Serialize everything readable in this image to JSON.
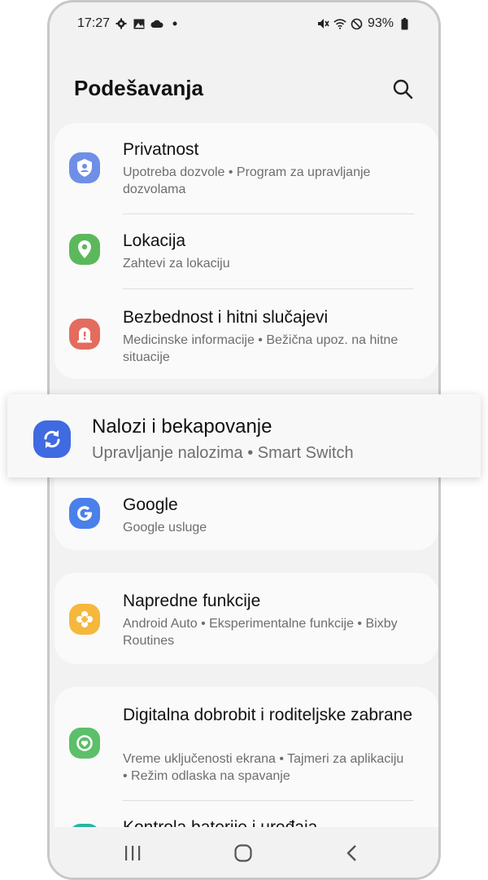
{
  "status": {
    "time": "17:27",
    "battery": "93%",
    "left_icons": [
      "gear-icon",
      "image-icon",
      "cloud-icon",
      "dot-icon"
    ],
    "right_icons": [
      "mute-icon",
      "wifi-icon",
      "do-not-disturb-icon",
      "battery-icon"
    ]
  },
  "header": {
    "title": "Podešavanja"
  },
  "items": [
    {
      "title": "Privatnost",
      "subtitle": "Upotreba dozvole  •  Program za upravljanje dozvolama",
      "icon": "shield-user-icon",
      "color": "#6f8fe6"
    },
    {
      "title": "Lokacija",
      "subtitle": "Zahtevi za lokaciju",
      "icon": "location-pin-icon",
      "color": "#5cb85c"
    },
    {
      "title": "Bezbednost i hitni slučajevi",
      "subtitle": "Medicinske informacije  •  Bežična upoz. na hitne situacije",
      "icon": "emergency-icon",
      "color": "#e36c5f"
    },
    {
      "title": "Google",
      "subtitle": "Google usluge",
      "icon": "google-icon",
      "color": "#4a80ea"
    },
    {
      "title": "Napredne funkcije",
      "subtitle": "Android Auto  •  Eksperimentalne funkcije  •  Bixby Routines",
      "icon": "advanced-features-icon",
      "color": "#f5b83d"
    },
    {
      "title": "Digitalna dobrobit i roditeljske zabrane",
      "subtitle": "Vreme uključenosti ekrana  •  Tajmeri za aplikaciju  •  Režim odlaska na spavanje",
      "icon": "wellbeing-icon",
      "color": "#5cbf6a"
    },
    {
      "title": "Kontrola baterije i uređaja",
      "icon": "battery-care-icon",
      "color": "#27b5a2"
    }
  ],
  "highlight": {
    "title": "Nalozi i bekapovanje",
    "subtitle": "Upravljanje nalozima  •  Smart Switch",
    "icon": "sync-icon",
    "color": "#3f6ae1"
  },
  "navbar": {
    "buttons": [
      "recents-icon",
      "home-icon",
      "back-icon"
    ]
  }
}
